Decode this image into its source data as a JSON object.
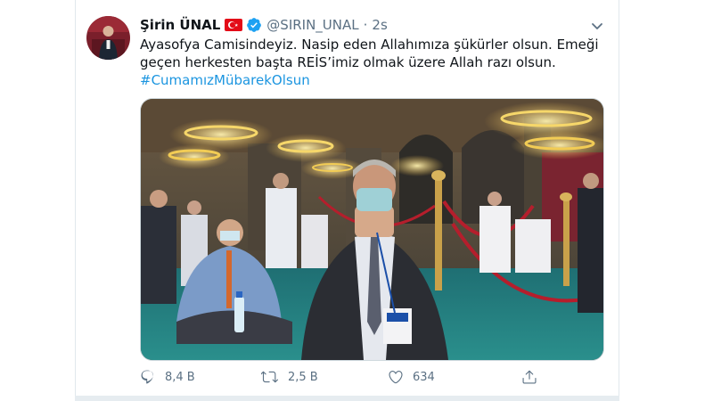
{
  "tweet": {
    "display_name": "Şirin ÜNAL",
    "handle": "@SIRIN_UNAL",
    "separator": "·",
    "time": "2s",
    "text": "Ayasofya Camisindeyiz. Nasip eden Allahımıza şükürler olsun. Emeği geçen herkesten başta REİS’imiz olmak üzere Allah razı olsun.",
    "hashtag": "#CumamızMübarekOlsun",
    "badges": {
      "flag_icon": "turkey-flag-icon",
      "verified_icon": "verified-badge-icon"
    },
    "image_subject": "mosque-interior-photo"
  },
  "actions": {
    "reply": {
      "icon": "reply-icon",
      "count": "8,4 B"
    },
    "retweet": {
      "icon": "retweet-icon",
      "count": "2,5 B"
    },
    "like": {
      "icon": "heart-icon",
      "count": "634"
    },
    "share": {
      "icon": "share-icon"
    }
  },
  "colors": {
    "text": "#0f1419",
    "secondary": "#5b7083",
    "link": "#1b95e0",
    "verified": "#1da1f2",
    "flag": "#e30a17"
  }
}
